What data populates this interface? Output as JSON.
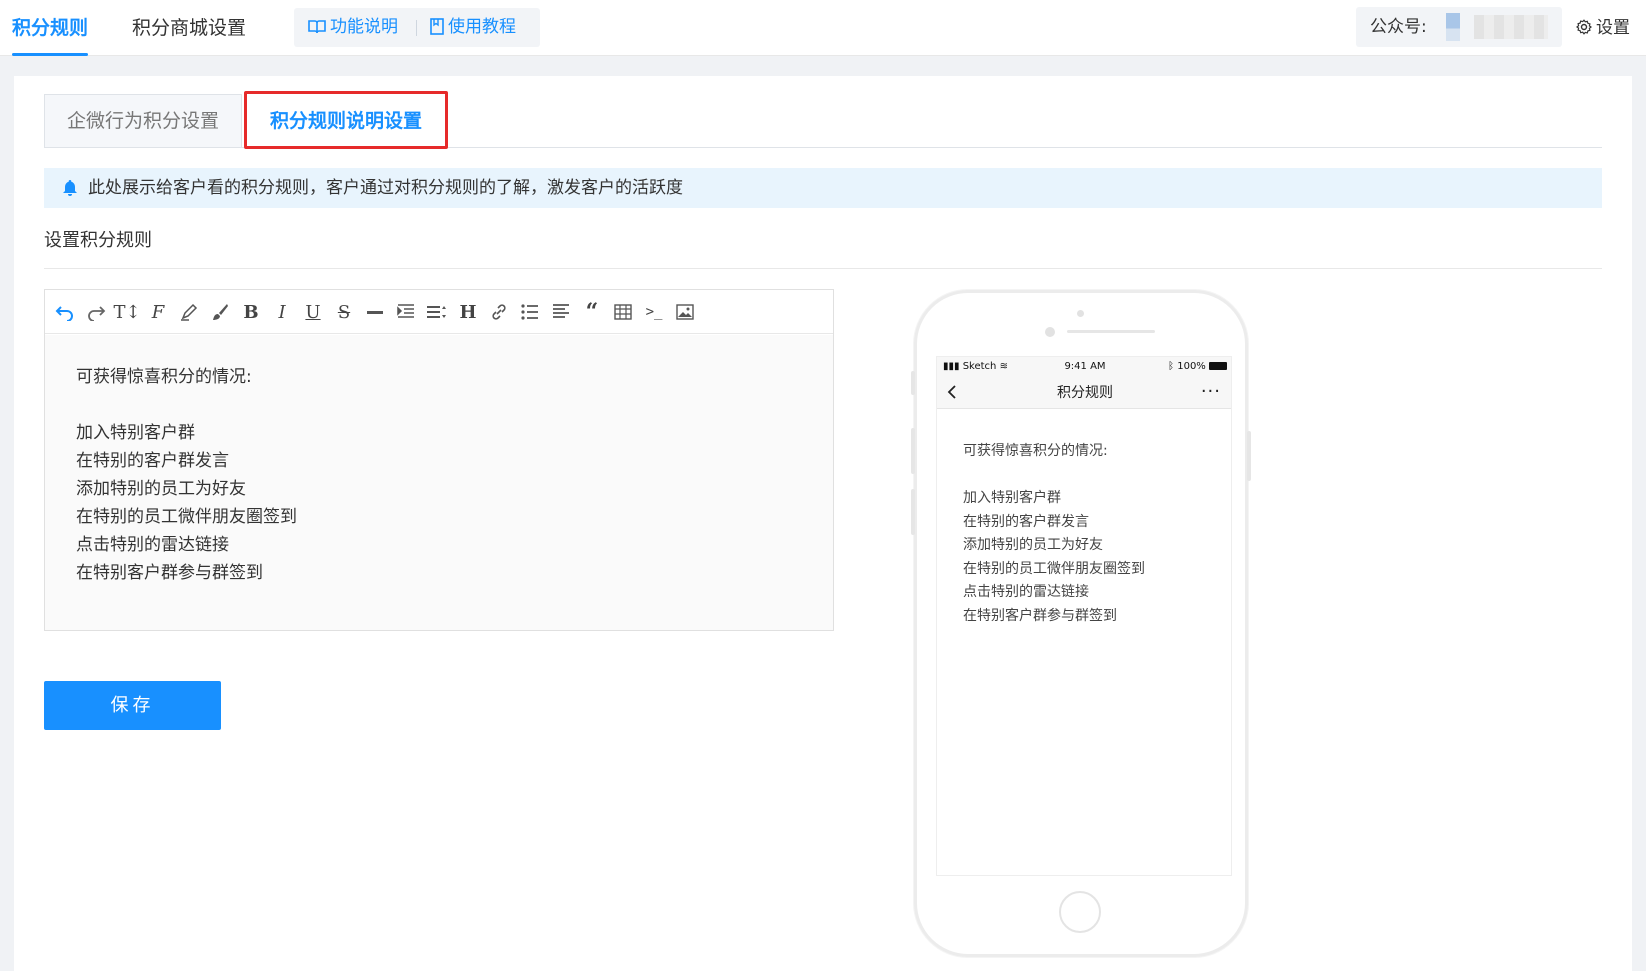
{
  "topnav": {
    "tab_rules": "积分规则",
    "tab_mall": "积分商城设置",
    "help_features": "功能说明",
    "help_tutorial": "使用教程",
    "account_label": "公众号:",
    "settings": "设置"
  },
  "tabs": {
    "behavior": "企微行为积分设置",
    "rules_desc": "积分规则说明设置"
  },
  "notice": "此处展示给客户看的积分规则，客户通过对积分规则的了解，激发客户的活跃度",
  "section_title": "设置积分规则",
  "toolbar_icons": [
    "undo-icon",
    "redo-icon",
    "font-size-icon",
    "font-family-icon",
    "highlight-icon",
    "paint-brush-icon",
    "bold-icon",
    "italic-icon",
    "underline-icon",
    "strikethrough-icon",
    "horizontal-rule-icon",
    "indent-icon",
    "line-height-icon",
    "heading-icon",
    "link-icon",
    "bullet-list-icon",
    "align-icon",
    "quote-icon",
    "table-icon",
    "code-icon",
    "image-icon"
  ],
  "content": {
    "heading": "可获得惊喜积分的情况:",
    "items": [
      "加入特别客户群",
      "在特别的客户群发言",
      "添加特别的员工为好友",
      "在特别的员工微伴朋友圈签到",
      "点击特别的雷达链接",
      "在特别客户群参与群签到"
    ]
  },
  "save_button": "保存",
  "phone": {
    "carrier": "Sketch",
    "time": "9:41 AM",
    "battery": "100%",
    "nav_title": "积分规则",
    "more": "···"
  },
  "colors": {
    "accent": "#1890ff",
    "highlight_border": "#e62a2a",
    "notice_bg": "#e8f4fd"
  }
}
